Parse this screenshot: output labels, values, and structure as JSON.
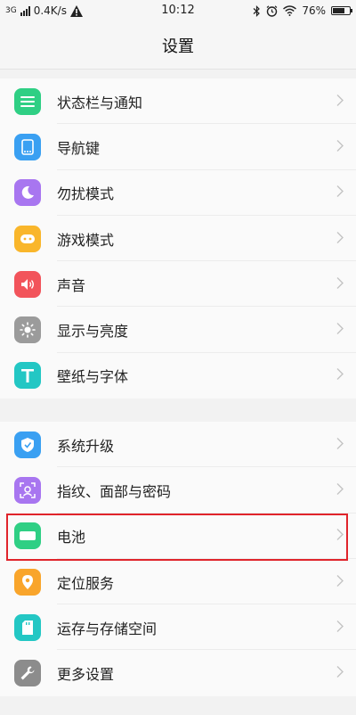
{
  "status_bar": {
    "network": "3G",
    "speed": "0.4K/s",
    "time": "10:12",
    "battery": "76%",
    "battery_level": 0.76
  },
  "header": {
    "title": "设置"
  },
  "groups": [
    {
      "items": [
        {
          "label": "状态栏与通知",
          "icon": "list-icon",
          "color": "#2fcf84"
        },
        {
          "label": "导航键",
          "icon": "navigation-icon",
          "color": "#3aa0f2"
        },
        {
          "label": "勿扰模式",
          "icon": "moon-icon",
          "color": "#a876f0"
        },
        {
          "label": "游戏模式",
          "icon": "gamepad-icon",
          "color": "#f9b62b"
        },
        {
          "label": "声音",
          "icon": "speaker-icon",
          "color": "#f2545b"
        },
        {
          "label": "显示与亮度",
          "icon": "sun-icon",
          "color": "#9b9b9b"
        },
        {
          "label": "壁纸与字体",
          "icon": "text-icon",
          "color": "#23c7c4"
        }
      ]
    },
    {
      "items": [
        {
          "label": "系统升级",
          "icon": "shield-icon",
          "color": "#3aa0f2"
        },
        {
          "label": "指纹、面部与密码",
          "icon": "face-icon",
          "color": "#a876f0"
        },
        {
          "label": "电池",
          "icon": "battery-icon",
          "color": "#2fcf84"
        },
        {
          "label": "定位服务",
          "icon": "location-icon",
          "color": "#f9a52b"
        },
        {
          "label": "运存与存储空间",
          "icon": "storage-icon",
          "color": "#23c7c4"
        },
        {
          "label": "更多设置",
          "icon": "wrench-icon",
          "color": "#8c8c8c"
        }
      ]
    }
  ],
  "highlight": {
    "color": "#e0242b"
  }
}
